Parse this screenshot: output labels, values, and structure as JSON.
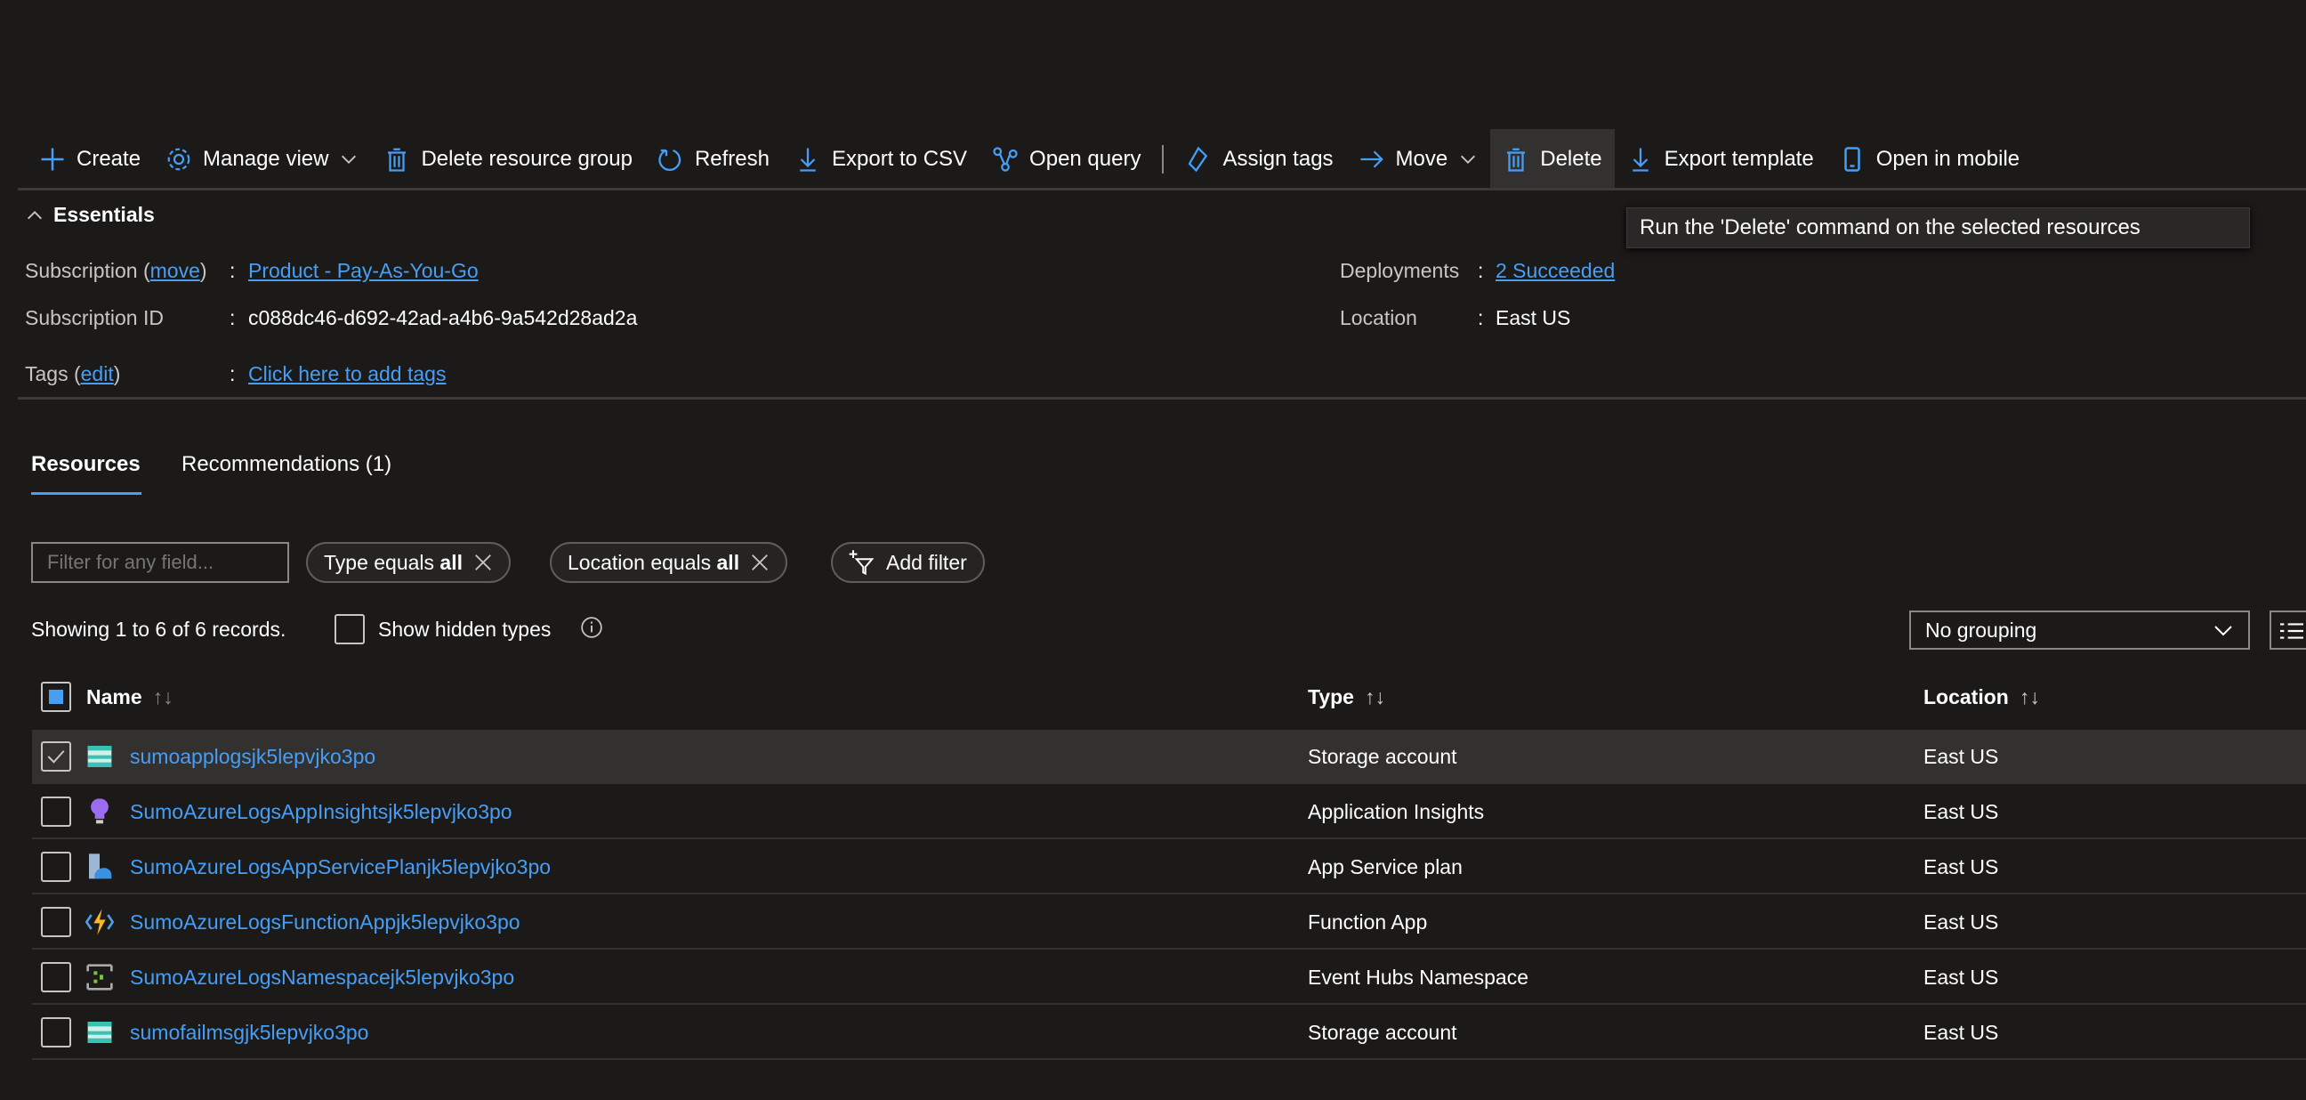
{
  "toolbar": {
    "create": "Create",
    "manage_view": "Manage view",
    "delete_rg": "Delete resource group",
    "refresh": "Refresh",
    "export_csv": "Export to CSV",
    "open_query": "Open query",
    "assign_tags": "Assign tags",
    "move": "Move",
    "delete": "Delete",
    "export_template": "Export template",
    "open_mobile": "Open in mobile"
  },
  "tooltip": "Run the 'Delete' command on the selected resources",
  "essentials": {
    "title": "Essentials",
    "subscription_label": "Subscription (",
    "subscription_move": "move",
    "subscription_close": ")",
    "subscription_value": "Product - Pay-As-You-Go",
    "subscription_id_label": "Subscription ID",
    "subscription_id_value": "c088dc46-d692-42ad-a4b6-9a542d28ad2a",
    "tags_label": "Tags (",
    "tags_edit": "edit",
    "tags_close": ")",
    "tags_value": "Click here to add tags",
    "deployments_label": "Deployments",
    "deployments_value": "2 Succeeded",
    "location_label": "Location",
    "location_value": "East US",
    "colon": ":"
  },
  "tabs": [
    {
      "label": "Resources",
      "active": true
    },
    {
      "label": "Recommendations (1)"
    }
  ],
  "filters": {
    "placeholder": "Filter for any field...",
    "type_pill": "Type equals ",
    "type_val": "all",
    "loc_pill": "Location equals ",
    "loc_val": "all",
    "add_filter": "Add filter"
  },
  "records": "Showing 1 to 6 of 6 records.",
  "show_hidden": "Show hidden types",
  "grouping": "No grouping",
  "columns": {
    "name": "Name",
    "type": "Type",
    "location": "Location"
  },
  "rows": [
    {
      "name": "sumoapplogsjk5lepvjko3po",
      "type": "Storage account",
      "location": "East US",
      "icon": "storage-account",
      "selected": true
    },
    {
      "name": "SumoAzureLogsAppInsightsjk5lepvjko3po",
      "type": "Application Insights",
      "location": "East US",
      "icon": "app-insights"
    },
    {
      "name": "SumoAzureLogsAppServicePlanjk5lepvjko3po",
      "type": "App Service plan",
      "location": "East US",
      "icon": "app-service-plan"
    },
    {
      "name": "SumoAzureLogsFunctionAppjk5lepvjko3po",
      "type": "Function App",
      "location": "East US",
      "icon": "function-app"
    },
    {
      "name": "SumoAzureLogsNamespacejk5lepvjko3po",
      "type": "Event Hubs Namespace",
      "location": "East US",
      "icon": "event-hubs"
    },
    {
      "name": "sumofailmsgjk5lepvjko3po",
      "type": "Storage account",
      "location": "East US",
      "icon": "storage-account"
    }
  ],
  "colors": {
    "accent": "#479ef5",
    "background": "#1b1a19",
    "selected_row": "#323130"
  }
}
